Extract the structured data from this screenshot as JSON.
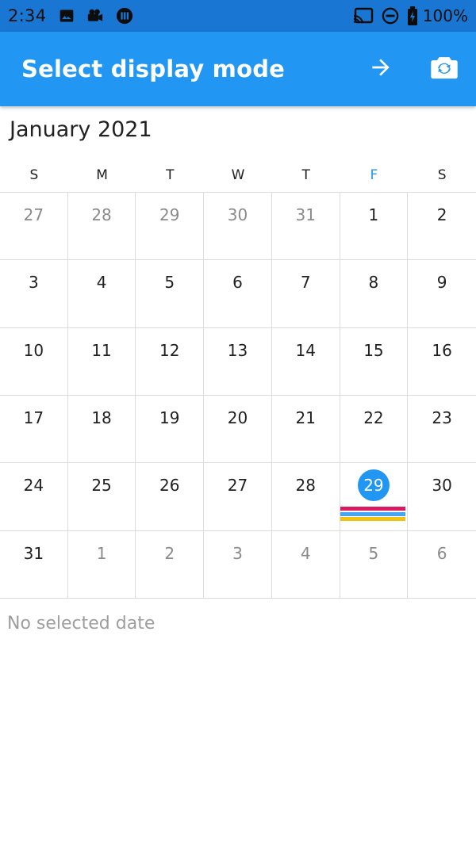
{
  "status_bar": {
    "time": "2:34",
    "battery": "100%",
    "icons": [
      "image-icon",
      "video-camera-icon",
      "media-icon",
      "cast-icon",
      "do-not-disturb-icon",
      "battery-icon"
    ]
  },
  "app_bar": {
    "title": "Select display mode",
    "actions": [
      "arrow-forward-icon",
      "switch-camera-icon"
    ]
  },
  "calendar": {
    "month_label": "January 2021",
    "weekdays": [
      "S",
      "M",
      "T",
      "W",
      "T",
      "F",
      "S"
    ],
    "today_weekday_index": 5,
    "weeks": [
      [
        {
          "d": "27",
          "o": true
        },
        {
          "d": "28",
          "o": true
        },
        {
          "d": "29",
          "o": true
        },
        {
          "d": "30",
          "o": true
        },
        {
          "d": "31",
          "o": true
        },
        {
          "d": "1"
        },
        {
          "d": "2"
        }
      ],
      [
        {
          "d": "3"
        },
        {
          "d": "4"
        },
        {
          "d": "5"
        },
        {
          "d": "6"
        },
        {
          "d": "7"
        },
        {
          "d": "8"
        },
        {
          "d": "9"
        }
      ],
      [
        {
          "d": "10"
        },
        {
          "d": "11"
        },
        {
          "d": "12"
        },
        {
          "d": "13"
        },
        {
          "d": "14"
        },
        {
          "d": "15"
        },
        {
          "d": "16"
        }
      ],
      [
        {
          "d": "17"
        },
        {
          "d": "18"
        },
        {
          "d": "19"
        },
        {
          "d": "20"
        },
        {
          "d": "21"
        },
        {
          "d": "22"
        },
        {
          "d": "23"
        }
      ],
      [
        {
          "d": "24"
        },
        {
          "d": "25"
        },
        {
          "d": "26"
        },
        {
          "d": "27"
        },
        {
          "d": "28"
        },
        {
          "d": "29",
          "today": true
        },
        {
          "d": "30"
        }
      ],
      [
        {
          "d": "31"
        },
        {
          "d": "1",
          "o": true
        },
        {
          "d": "2",
          "o": true
        },
        {
          "d": "3",
          "o": true
        },
        {
          "d": "4",
          "o": true
        },
        {
          "d": "5",
          "o": true
        },
        {
          "d": "6",
          "o": true
        }
      ]
    ],
    "events_on_today": [
      {
        "color": "#d81b60"
      },
      {
        "color": "#42a5f5"
      },
      {
        "color": "#f4c20d"
      }
    ]
  },
  "selection": {
    "empty_text": "No selected date"
  },
  "colors": {
    "primary": "#2196f3",
    "primary_dark": "#1976d2",
    "other_month_text": "#8a8a8a"
  }
}
